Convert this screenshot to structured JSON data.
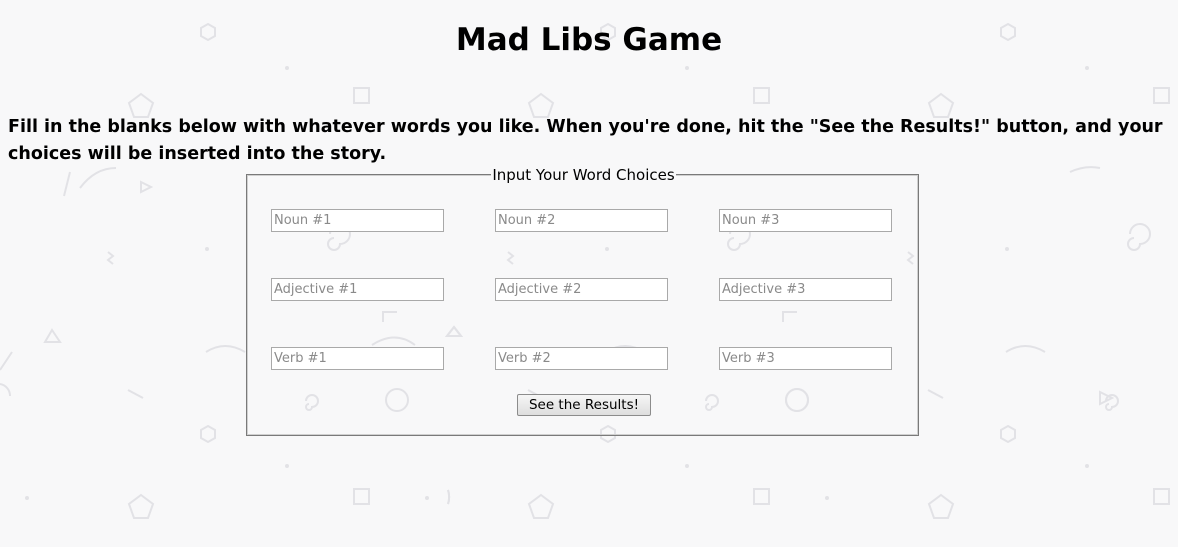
{
  "page": {
    "title": "Mad Libs Game",
    "instructions": "Fill in the blanks below with whatever words you like. When you're done, hit the \"See the Results!\" button, and your choices will be inserted into the story."
  },
  "form": {
    "legend": "Input Your Word Choices",
    "fields": [
      {
        "placeholder": "Noun #1",
        "value": ""
      },
      {
        "placeholder": "Noun #2",
        "value": ""
      },
      {
        "placeholder": "Noun #3",
        "value": ""
      },
      {
        "placeholder": "Adjective #1",
        "value": ""
      },
      {
        "placeholder": "Adjective #2",
        "value": ""
      },
      {
        "placeholder": "Adjective #3",
        "value": ""
      },
      {
        "placeholder": "Verb #1",
        "value": ""
      },
      {
        "placeholder": "Verb #2",
        "value": ""
      },
      {
        "placeholder": "Verb #3",
        "value": ""
      }
    ],
    "submit_label": "See the Results!"
  },
  "theme": {
    "background": "#f8f8f9",
    "pattern_color": "#e3e3e6"
  }
}
